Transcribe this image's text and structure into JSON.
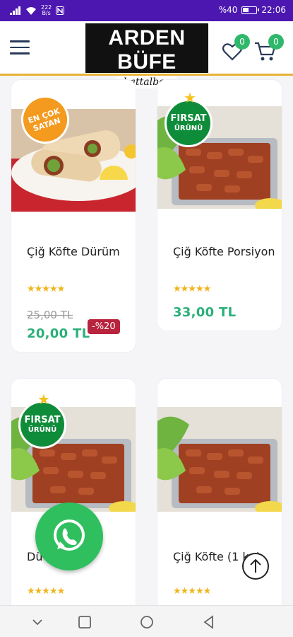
{
  "status_bar": {
    "speed_value": "222",
    "speed_unit": "B/s",
    "battery_text": "%40",
    "time": "22:06"
  },
  "header": {
    "logo_title": "ARDEN BÜFE",
    "logo_subtitle": "battalbey",
    "favorites_count": "0",
    "cart_count": "0"
  },
  "colors": {
    "status_bar": "#4b17b0",
    "accent_line": "#e8b33a",
    "price_green": "#2bb07a",
    "badge_green": "#2fb86b",
    "discount_red": "#b8233d",
    "star_gold": "#f0b51e"
  },
  "stickers": {
    "best_seller": [
      "EN ÇOK",
      "SATAN"
    ],
    "opportunity": [
      "FIRSAT",
      "ÜRÜNÜ"
    ]
  },
  "products": [
    {
      "title": "Çiğ Köfte Dürüm",
      "rating": 5,
      "stars": "★★★★★",
      "old_price": "25,00 TL",
      "price": "20,00 TL",
      "discount": "-%20"
    },
    {
      "title": "Çiğ Köfte Porsiyon",
      "rating": 5,
      "stars": "★★★★★",
      "price": "33,00 TL"
    },
    {
      "title": "Dü Köfte...",
      "rating": 5,
      "stars": "★★★★★"
    },
    {
      "title": "Çiğ Köfte (1 kg)",
      "rating": 5,
      "stars": "★★★★★"
    }
  ],
  "icons": {
    "menu": "menu-icon",
    "favorites": "heart-icon",
    "cart": "cart-icon",
    "whatsapp": "whatsapp-icon",
    "scroll_top": "arrow-up-icon",
    "nav": [
      "chevron-down-icon",
      "square-icon",
      "circle-icon",
      "triangle-back-icon"
    ]
  }
}
